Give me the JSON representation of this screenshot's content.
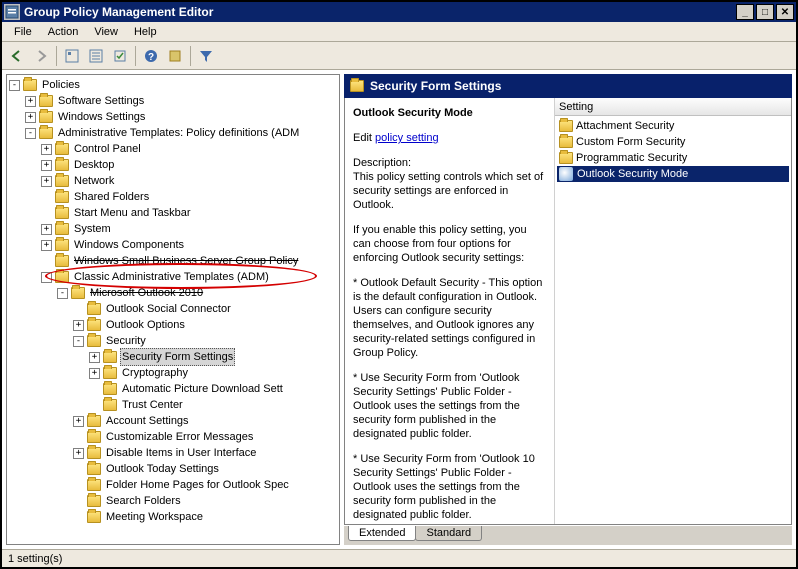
{
  "window": {
    "title": "Group Policy Management Editor"
  },
  "menubar": [
    "File",
    "Action",
    "View",
    "Help"
  ],
  "tree": {
    "root": "Policies",
    "software_settings": "Software Settings",
    "windows_settings": "Windows Settings",
    "admin_templates": "Administrative Templates: Policy definitions (ADM",
    "control_panel": "Control Panel",
    "desktop": "Desktop",
    "network": "Network",
    "shared_folders": "Shared Folders",
    "start_menu": "Start Menu and Taskbar",
    "system": "System",
    "windows_components": "Windows Components",
    "wsbs_gp": "Windows Small Business Server Group Policy",
    "classic_adm": "Classic Administrative Templates (ADM)",
    "outlook_2010": "Microsoft Outlook 2010",
    "social_connector": "Outlook Social Connector",
    "outlook_options": "Outlook Options",
    "security": "Security",
    "security_form": "Security Form Settings",
    "cryptography": "Cryptography",
    "auto_pic": "Automatic Picture Download Sett",
    "trust_center": "Trust Center",
    "account_settings": "Account Settings",
    "custom_errors": "Customizable Error Messages",
    "disable_items": "Disable Items in User Interface",
    "outlook_today": "Outlook Today Settings",
    "folder_home": "Folder Home Pages for Outlook Spec",
    "search_folders": "Search Folders",
    "meeting_workspace": "Meeting Workspace"
  },
  "right_pane": {
    "header": "Security Form Settings",
    "topic_title": "Outlook Security Mode",
    "edit_prefix": "Edit ",
    "edit_link": "policy setting",
    "desc_label": "Description:",
    "desc_p1": "This policy setting controls which set of security settings are enforced in Outlook.",
    "desc_p2": " If you enable this policy setting, you can choose from four options for enforcing Outlook security settings:",
    "desc_p3": "* Outlook Default Security - This option is the default configuration in Outlook. Users can configure security themselves, and Outlook ignores any security-related settings configured in Group Policy.",
    "desc_p4": "* Use Security Form from 'Outlook Security Settings' Public Folder - Outlook uses the settings from the security form published in the designated public folder.",
    "desc_p5": "* Use Security Form from 'Outlook 10 Security Settings' Public Folder - Outlook uses the settings from the security form published in the designated public folder.",
    "list_header": "Setting",
    "list": [
      "Attachment Security",
      "Custom Form Security",
      "Programmatic Security",
      "Outlook Security Mode"
    ],
    "tabs": {
      "extended": "Extended",
      "standard": "Standard"
    }
  },
  "statusbar": "1 setting(s)"
}
